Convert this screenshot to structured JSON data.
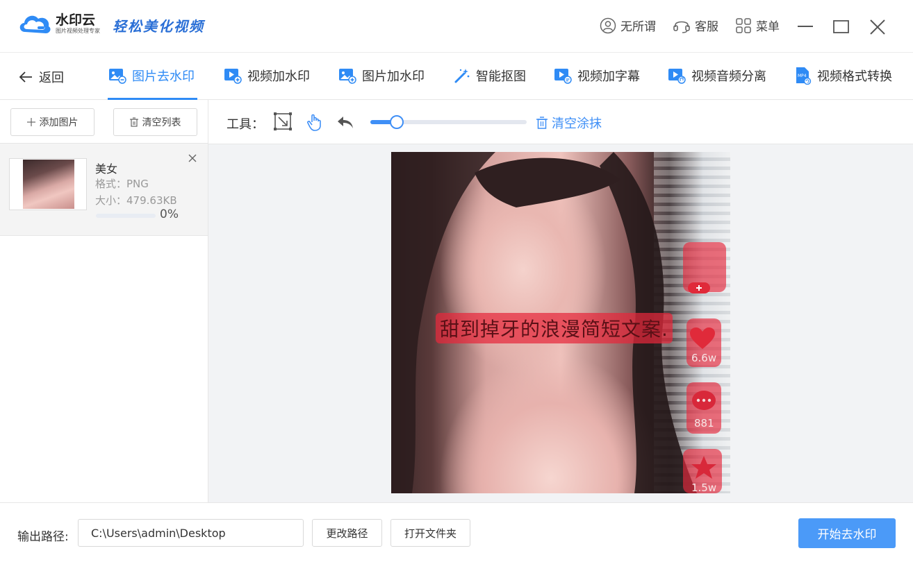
{
  "app": {
    "name": "水印云",
    "subtitle": "图片视频处理专家",
    "slogan": "轻松美化视频",
    "brand_color": "#2f8bf5"
  },
  "titlebar": {
    "user_label": "无所谓",
    "service_label": "客服",
    "menu_label": "菜单",
    "icons": [
      "user-icon",
      "headset-icon",
      "grid-menu-icon",
      "minimize-icon",
      "maximize-icon",
      "close-icon"
    ]
  },
  "nav": {
    "back_label": "返回",
    "tabs": [
      {
        "label": "图片去水印",
        "icon": "image-remove-icon",
        "active": true
      },
      {
        "label": "视频加水印",
        "icon": "video-add-icon",
        "active": false
      },
      {
        "label": "图片加水印",
        "icon": "image-add-icon",
        "active": false
      },
      {
        "label": "智能抠图",
        "icon": "magic-wand-icon",
        "active": false
      },
      {
        "label": "视频加字幕",
        "icon": "video-subtitle-icon",
        "active": false
      },
      {
        "label": "视频音频分离",
        "icon": "video-audio-icon",
        "active": false
      },
      {
        "label": "视频格式转换",
        "icon": "mp4-file-icon",
        "active": false
      }
    ]
  },
  "file_list": {
    "add_label": "添加图片",
    "clear_label": "清空列表",
    "items": [
      {
        "name": "美女",
        "format": "格式：PNG",
        "size": "大小：479.63KB",
        "progress": 0,
        "progress_text": "0%"
      }
    ]
  },
  "tools": {
    "label": "工具：",
    "clear_smear_label": "清空涂抹",
    "brush_size_fraction": 0.17,
    "active_tool": "hand"
  },
  "image": {
    "caption_text": "甜到掉牙的浪漫简短文案.",
    "likes": "6.6w",
    "comments": "881",
    "stars": "1.5w"
  },
  "output": {
    "label": "输出路径:",
    "path": "C:\\Users\\admin\\Desktop",
    "change_label": "更改路径",
    "open_label": "打开文件夹",
    "start_label": "开始去水印"
  }
}
